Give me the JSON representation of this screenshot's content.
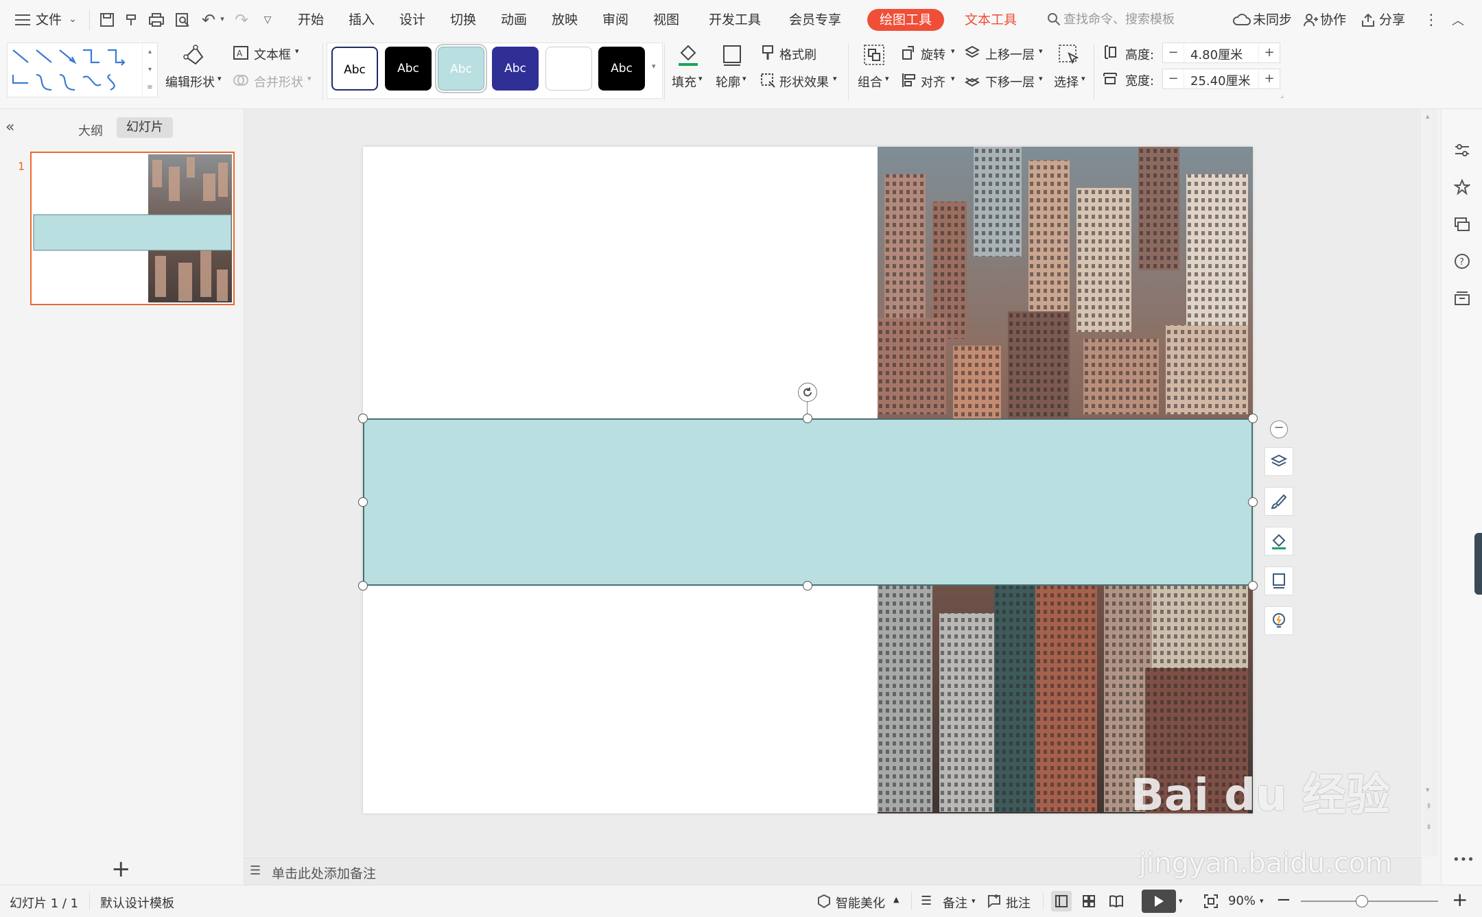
{
  "menu": {
    "file": "文件",
    "tabs": [
      "开始",
      "插入",
      "设计",
      "切换",
      "动画",
      "放映",
      "审阅",
      "视图",
      "开发工具",
      "会员专享"
    ],
    "active_tab": "绘图工具",
    "text_tool": "文本工具",
    "search_placeholder": "查找命令、搜索模板",
    "sync": "未同步",
    "collaborate": "协作",
    "share": "分享"
  },
  "ribbon": {
    "edit_shape": "编辑形状",
    "text_box": "文本框",
    "merge_shape": "合并形状",
    "style_sample": "Abc",
    "fill": "填充",
    "outline": "轮廓",
    "format_painter": "格式刷",
    "shape_effect": "形状效果",
    "group": "组合",
    "rotate": "旋转",
    "align": "对齐",
    "bring_forward": "上移一层",
    "send_backward": "下移一层",
    "select": "选择",
    "height_label": "高度:",
    "height_value": "4.80厘米",
    "width_label": "宽度:",
    "width_value": "25.40厘米"
  },
  "left_panel": {
    "outline_tab": "大纲",
    "slides_tab": "幻灯片",
    "slide_number": "1"
  },
  "notes_placeholder": "单击此处添加备注",
  "status": {
    "slide_info": "幻灯片 1 / 1",
    "template": "默认设计模板",
    "smart_beautify": "智能美化",
    "notes": "备注",
    "comments": "批注",
    "zoom": "90%"
  },
  "watermark": {
    "brand": "Bai du 经验",
    "url": "jingyan.baidu.com"
  },
  "colors": {
    "accent_orange": "#f04e37",
    "shape_fill": "#b9dfe1",
    "text_tool_color": "#f04e37",
    "thumb_border": "#e8692f"
  }
}
